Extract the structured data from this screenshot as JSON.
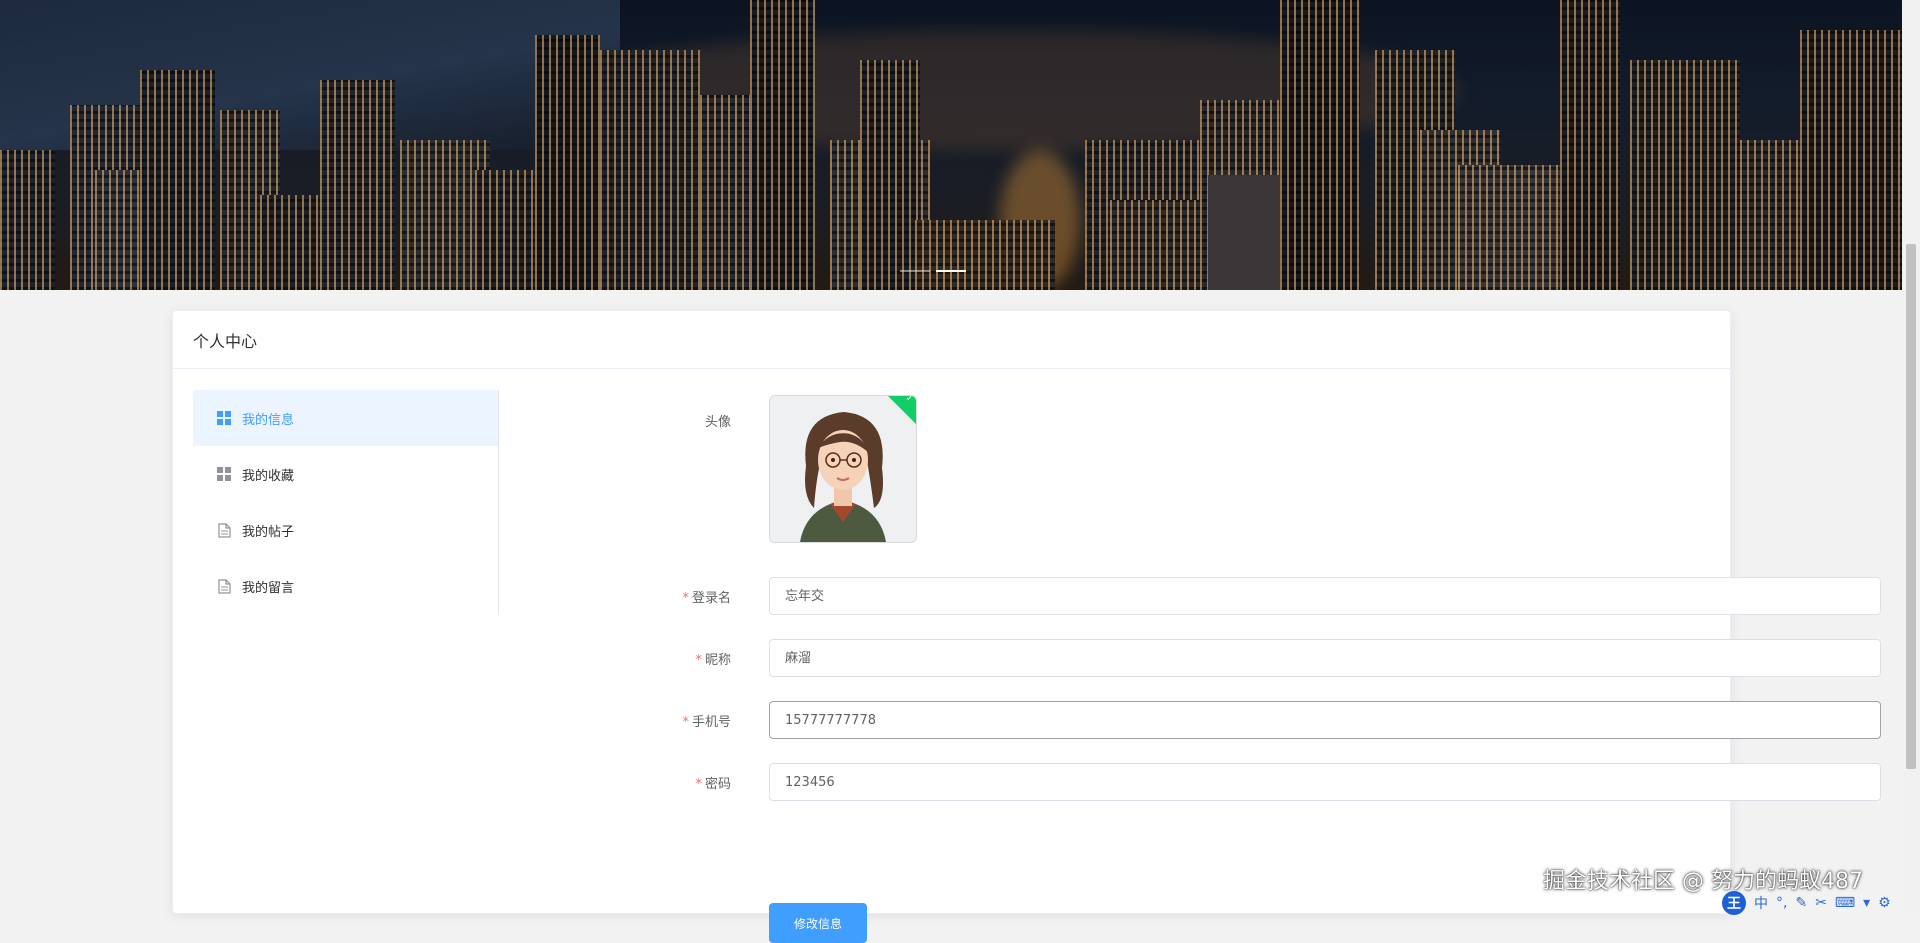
{
  "card": {
    "title": "个人中心"
  },
  "menu": [
    {
      "label": "我的信息",
      "icon": "grid-icon",
      "active": true
    },
    {
      "label": "我的收藏",
      "icon": "grid-icon",
      "active": false
    },
    {
      "label": "我的帖子",
      "icon": "document-icon",
      "active": false
    },
    {
      "label": "我的留言",
      "icon": "document-icon",
      "active": false
    }
  ],
  "form": {
    "avatar_label": "头像",
    "avatar_check": "✓",
    "fields": [
      {
        "label": "登录名",
        "value": "忘年交",
        "required": true
      },
      {
        "label": "昵称",
        "value": "麻溜",
        "required": true
      },
      {
        "label": "手机号",
        "value": "15777777778",
        "required": true
      },
      {
        "label": "密码",
        "value": "123456",
        "required": true
      }
    ],
    "submit_label": "修改信息"
  },
  "watermark": "掘金技术社区 @ 努力的蚂蚁487",
  "ime_toolbar": {
    "logo": "王",
    "mode": "中",
    "icons": [
      "punctuation-icon",
      "pen-icon",
      "scissors-icon",
      "keyboard-icon",
      "shirt-icon",
      "settings-icon"
    ]
  },
  "colors": {
    "accent": "#409eff",
    "active_bg": "#ecf5ff",
    "required": "#f56c6c",
    "success": "#13ce66"
  }
}
